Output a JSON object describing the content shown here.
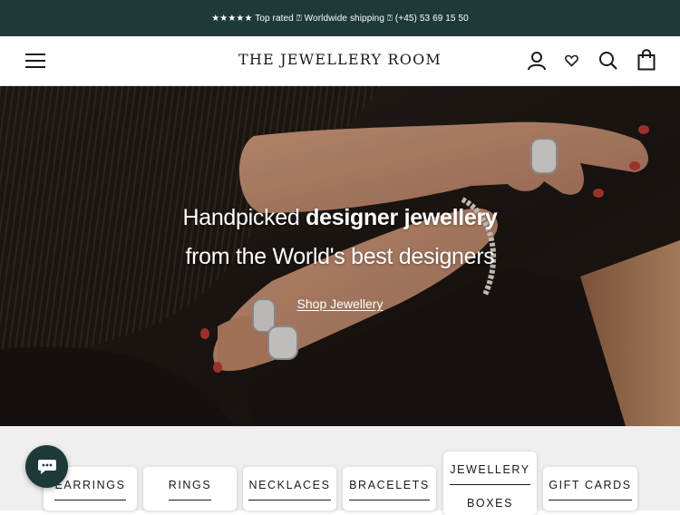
{
  "announcement": {
    "text": "★★★★★ Top rated ⍰ Worldwide shipping ⍰ (+45) 53 69 15 50"
  },
  "header": {
    "logo": "THE JEWELLERY ROOM",
    "icons": [
      "menu-icon",
      "account-icon",
      "wishlist-heart-icon",
      "search-icon",
      "cart-bag-icon"
    ]
  },
  "hero": {
    "line1_regular": "Handpicked ",
    "line1_bold": "designer jewellery",
    "line2": "from the World's best designers",
    "cta": "Shop Jewellery"
  },
  "categories": [
    {
      "label": "EARRINGS"
    },
    {
      "label": "RINGS"
    },
    {
      "label": "NECKLACES"
    },
    {
      "label": "BRACELETS"
    },
    {
      "label_line1": "JEWELLERY",
      "label_line2": "BOXES"
    },
    {
      "label": "GIFT CARDS"
    }
  ],
  "chat": {
    "icon": "chat-bubble-icon"
  },
  "colors": {
    "brand": "#1d3a38",
    "category_bg": "#efefef"
  }
}
